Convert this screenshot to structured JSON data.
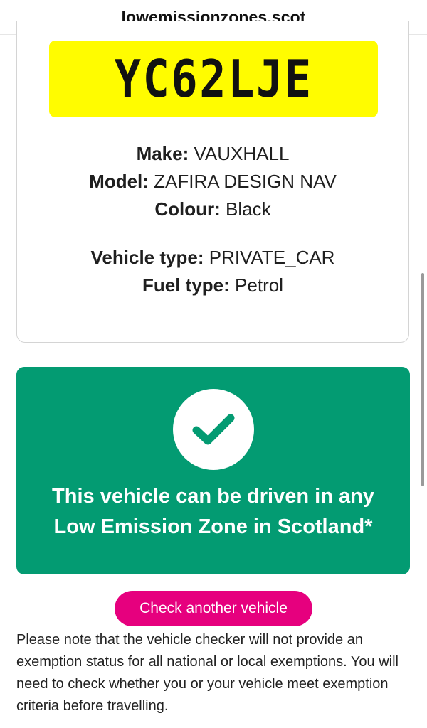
{
  "browser": {
    "url": "lowemissionzones.scot"
  },
  "vehicle": {
    "registration": "YC62LJE",
    "make_label": "Make:",
    "make_value": "VAUXHALL",
    "model_label": "Model:",
    "model_value": "ZAFIRA DESIGN NAV",
    "colour_label": "Colour:",
    "colour_value": "Black",
    "vehicle_type_label": "Vehicle type:",
    "vehicle_type_value": "PRIVATE_CAR",
    "fuel_type_label": "Fuel type:",
    "fuel_type_value": "Petrol"
  },
  "result": {
    "icon": "check-icon",
    "line1": "This vehicle can be driven in any",
    "line2": "Low Emission Zone in Scotland*",
    "color": "#039b72"
  },
  "actions": {
    "check_another_label": "Check another vehicle",
    "button_color": "#e6007e"
  },
  "note": {
    "text": "Please note that the vehicle checker will not provide an exemption status for all national or local exemptions. You will need to check whether you or your vehicle meet exemption criteria before travelling."
  },
  "colors": {
    "plate_yellow": "#fffc00"
  }
}
